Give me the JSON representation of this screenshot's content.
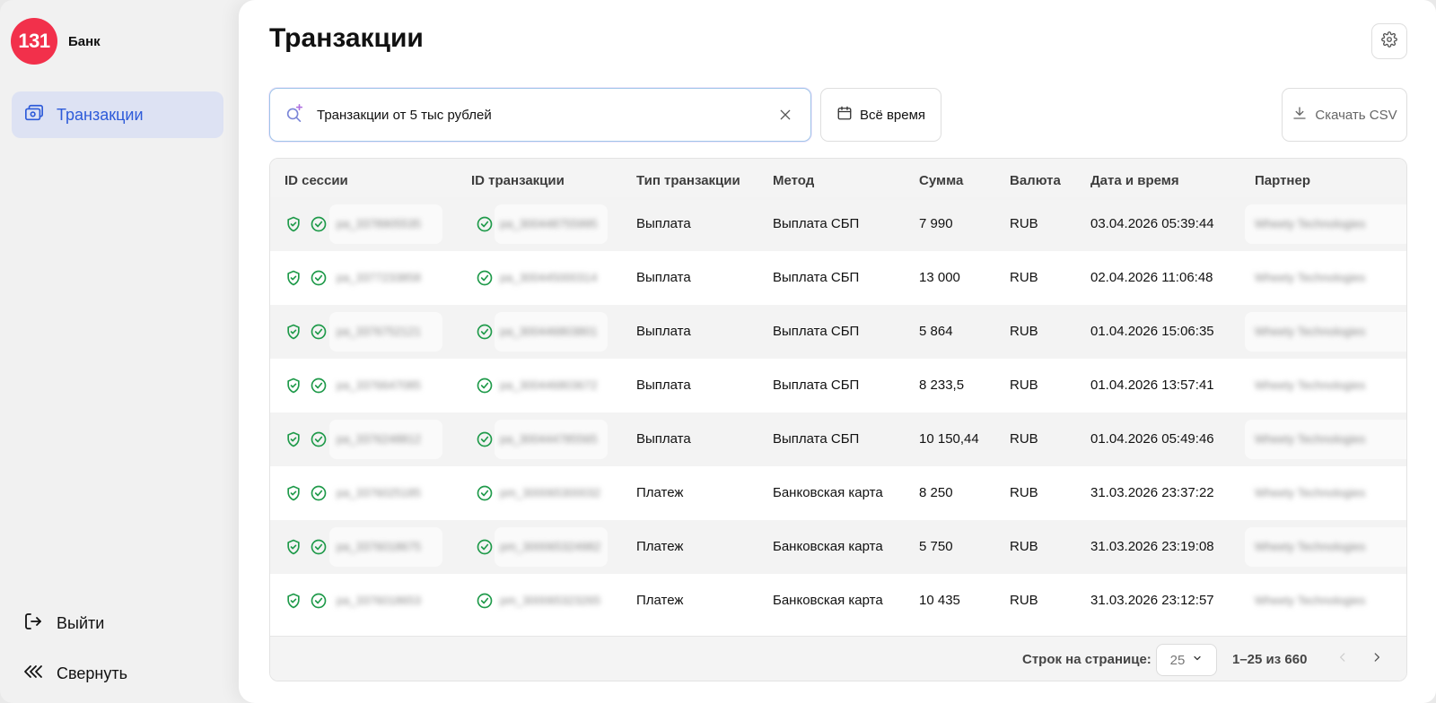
{
  "brand": {
    "logo_number": "131",
    "name": "Банк",
    "color": "#f2304b"
  },
  "sidebar": {
    "items": [
      {
        "label": "Транзакции",
        "icon": "wallet-icon",
        "active": true
      }
    ],
    "logout_label": "Выйти",
    "collapse_label": "Свернуть"
  },
  "page": {
    "title": "Транзакции"
  },
  "toolbar": {
    "search_value": "Транзакции от 5 тыс рублей",
    "date_label": "Всё время",
    "csv_label": "Скачать CSV"
  },
  "table": {
    "columns": [
      "ID сессии",
      "ID транзакции",
      "Тип транзакции",
      "Метод",
      "Сумма",
      "Валюта",
      "Дата и время",
      "Партнер"
    ],
    "rows": [
      {
        "session_id": "pa_3378905535",
        "transaction_id": "pa_300448755995",
        "type": "Выплата",
        "method": "Выплата СБП",
        "amount": "7 990",
        "currency": "RUB",
        "datetime": "03.04.2026 05:39:44",
        "partner": "Wheety Technologies"
      },
      {
        "session_id": "pa_3377233858",
        "transaction_id": "pa_300445000314",
        "type": "Выплата",
        "method": "Выплата СБП",
        "amount": "13 000",
        "currency": "RUB",
        "datetime": "02.04.2026 11:06:48",
        "partner": "Wheety Technologies"
      },
      {
        "session_id": "pa_3376752121",
        "transaction_id": "pa_300446803801",
        "type": "Выплата",
        "method": "Выплата СБП",
        "amount": "5 864",
        "currency": "RUB",
        "datetime": "01.04.2026 15:06:35",
        "partner": "Wheety Technologies"
      },
      {
        "session_id": "pa_3376647085",
        "transaction_id": "pa_300446803672",
        "type": "Выплата",
        "method": "Выплата СБП",
        "amount": "8 233,5",
        "currency": "RUB",
        "datetime": "01.04.2026 13:57:41",
        "partner": "Wheety Technologies"
      },
      {
        "session_id": "pa_3376248812",
        "transaction_id": "pa_300444785565",
        "type": "Выплата",
        "method": "Выплата СБП",
        "amount": "10 150,44",
        "currency": "RUB",
        "datetime": "01.04.2026 05:49:46",
        "partner": "Wheety Technologies"
      },
      {
        "session_id": "pa_3376025185",
        "transaction_id": "pm_300065300032",
        "type": "Платеж",
        "method": "Банковская карта",
        "amount": "8 250",
        "currency": "RUB",
        "datetime": "31.03.2026 23:37:22",
        "partner": "Wheety Technologies"
      },
      {
        "session_id": "pa_3376018675",
        "transaction_id": "pm_300065324982",
        "type": "Платеж",
        "method": "Банковская карта",
        "amount": "5 750",
        "currency": "RUB",
        "datetime": "31.03.2026 23:19:08",
        "partner": "Wheety Technologies"
      },
      {
        "session_id": "pa_3376018653",
        "transaction_id": "pm_300065323265",
        "type": "Платеж",
        "method": "Банковская карта",
        "amount": "10 435",
        "currency": "RUB",
        "datetime": "31.03.2026 23:12:57",
        "partner": "Wheety Technologies"
      }
    ]
  },
  "pagination": {
    "rows_per_page_label": "Строк на странице:",
    "rows_per_page_value": "25",
    "range_label": "1–25 из 660"
  },
  "colors": {
    "accent": "#2e5bd9",
    "nav_active_bg": "#dde2f3",
    "status_green": "#1f9a4a"
  }
}
